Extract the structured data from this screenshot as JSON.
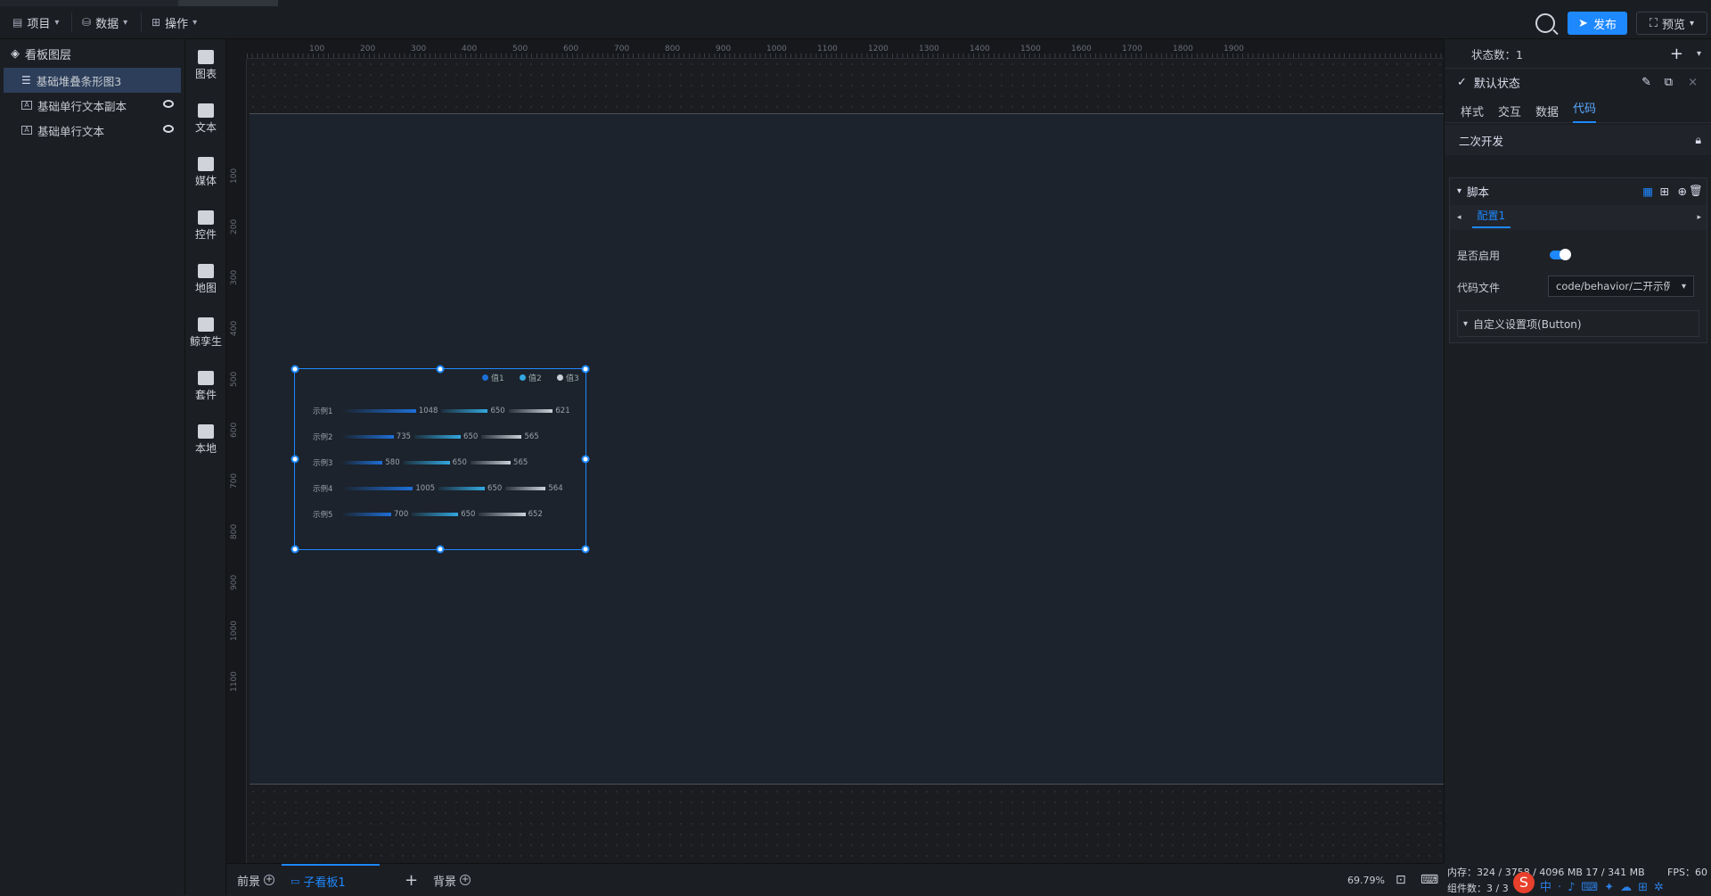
{
  "toolbar": {
    "project_label": "项目",
    "data_label": "数据",
    "ops_label": "操作",
    "publish_label": "发布",
    "preview_label": "预览"
  },
  "layers": {
    "title": "看板图层",
    "items": [
      {
        "label": "基础堆叠条形图3",
        "selected": true
      },
      {
        "label": "基础单行文本副本",
        "hidden": true
      },
      {
        "label": "基础单行文本",
        "hidden": true
      }
    ]
  },
  "components": [
    {
      "label": "图表",
      "icon": "bar-chart-icon"
    },
    {
      "label": "文本",
      "icon": "crown-icon"
    },
    {
      "label": "媒体",
      "icon": "camera-icon"
    },
    {
      "label": "控件",
      "icon": "control-icon"
    },
    {
      "label": "地图",
      "icon": "map-icon"
    },
    {
      "label": "鲸孪生",
      "icon": "cube-icon"
    },
    {
      "label": "套件",
      "icon": "shirt-icon"
    },
    {
      "label": "本地",
      "icon": "puzzle-icon"
    }
  ],
  "ruler": {
    "top": [
      "100",
      "200",
      "300",
      "400",
      "500",
      "600",
      "700",
      "800",
      "900",
      "1000",
      "1100",
      "1200",
      "1300",
      "1400",
      "1500",
      "1600",
      "1700",
      "1800",
      "1900"
    ],
    "left": [
      "100",
      "200",
      "300",
      "400",
      "500",
      "600",
      "700",
      "800",
      "900",
      "1000",
      "1100"
    ]
  },
  "chart_data": {
    "type": "bar",
    "orientation": "horizontal",
    "stacked": true,
    "categories": [
      "示例1",
      "示例2",
      "示例3",
      "示例4",
      "示例5"
    ],
    "series": [
      {
        "name": "值1",
        "values": [
          1048,
          735,
          580,
          1005,
          700
        ],
        "color": "#1d6fd8"
      },
      {
        "name": "值2",
        "values": [
          650,
          650,
          650,
          650,
          650
        ],
        "color": "#33a8e0"
      },
      {
        "name": "值3",
        "values": [
          621,
          565,
          565,
          564,
          652
        ],
        "color": "#c8d0d8"
      }
    ],
    "legend": "top-right"
  },
  "bottom": {
    "tab_front": "前景",
    "tab_sub": "子看板1",
    "tab_back": "背景",
    "zoom": "69.79%"
  },
  "right": {
    "state_count": "状态数：1",
    "default_state": "默认状态",
    "tabs": [
      "样式",
      "交互",
      "数据",
      "代码"
    ],
    "active_tab": "代码",
    "dev_title": "二次开发",
    "script_title": "脚本",
    "config_tab": "配置1",
    "enable_label": "是否启用",
    "file_label": "代码文件",
    "file_value": "code/behavior/二开示例",
    "custom_label": "自定义设置项(Button)"
  },
  "status": {
    "memory": "内存：324 / 3758 / 4096 MB  17 / 341 MB",
    "fps": "FPS：60",
    "components": "组件数：3 / 3"
  },
  "accent": "#1e88ff"
}
